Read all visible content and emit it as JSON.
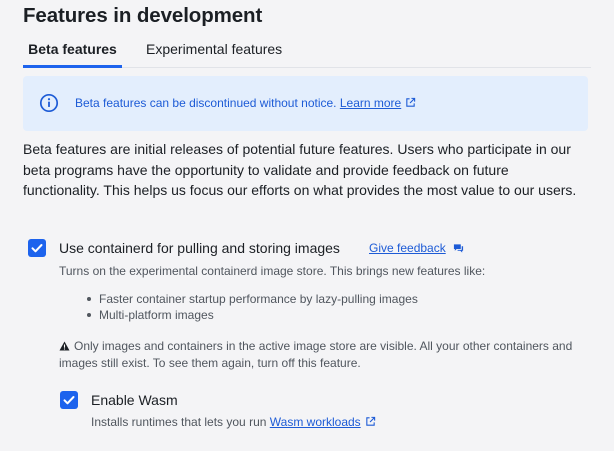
{
  "page": {
    "title": "Features in development"
  },
  "tabs": [
    {
      "label": "Beta features",
      "active": true
    },
    {
      "label": "Experimental features",
      "active": false
    }
  ],
  "banner": {
    "text": "Beta features can be discontinued without notice.",
    "link": "Learn more",
    "icon": "info-icon",
    "color": "#1d5bd6",
    "background": "#e3eefd"
  },
  "intro": "Beta features are initial releases of potential future features. Users who participate in our beta programs have the opportunity to validate and provide feedback on future functionality. This helps us focus our efforts on what provides the most value to our users.",
  "features": {
    "containerd": {
      "label": "Use containerd for pulling and storing images",
      "checked": true,
      "feedback_link": "Give feedback",
      "description": "Turns on the experimental containerd image store. This brings new features like:",
      "bullets": [
        "Faster container startup performance by lazy-pulling images",
        "Multi-platform images"
      ],
      "warning": "Only images and containers in the active image store are visible. All your other containers and images still exist. To see them again, turn off this feature."
    },
    "wasm": {
      "label": "Enable Wasm",
      "checked": true,
      "description_prefix": "Installs runtimes that lets you run",
      "link": "Wasm workloads"
    }
  },
  "accent_color": "#1d63ed"
}
